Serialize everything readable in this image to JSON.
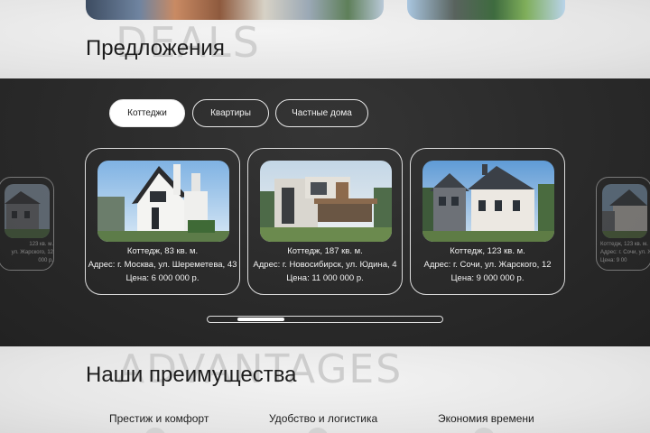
{
  "deals": {
    "ghost_text": "DEALS",
    "title": "Предложения"
  },
  "tabs": [
    {
      "label": "Коттеджи",
      "active": true
    },
    {
      "label": "Квартиры",
      "active": false
    },
    {
      "label": "Частные дома",
      "active": false
    }
  ],
  "cards": [
    {
      "line1": "Коттедж, 83 кв. м.",
      "line2": "Адрес: г. Москва, ул. Шереметева, 43",
      "line3": "Цена: 6 000 000 р."
    },
    {
      "line1": "Коттедж, 187 кв. м.",
      "line2": "Адрес: г. Новосибирск, ул. Юдина, 4",
      "line3": "Цена: 11 000 000 р."
    },
    {
      "line1": "Коттедж, 123 кв. м.",
      "line2": "Адрес: г. Сочи, ул. Жарского, 12",
      "line3": "Цена: 9 000 000 р."
    }
  ],
  "ghost_cards": {
    "left": {
      "line1": "123 кв. м.",
      "line2": "ул. Жарского, 12",
      "line3": "000 р."
    },
    "right": {
      "line1": "Коттедж, 123 кв. м.",
      "line2": "Адрес: г. Сочи, ул. Жарского, 12",
      "line3": "Цена: 9 00"
    }
  },
  "advantages": {
    "ghost_text": "ADVANTAGES",
    "title": "Наши преимущества",
    "items": [
      "Престиж и комфорт",
      "Удобство и логистика",
      "Экономия времени"
    ]
  },
  "scrollbar": {
    "position": 0.16
  },
  "colors": {
    "dark_band": "#2a2a2a",
    "light_band": "#e9e9e9",
    "accent": "#ffffff"
  }
}
